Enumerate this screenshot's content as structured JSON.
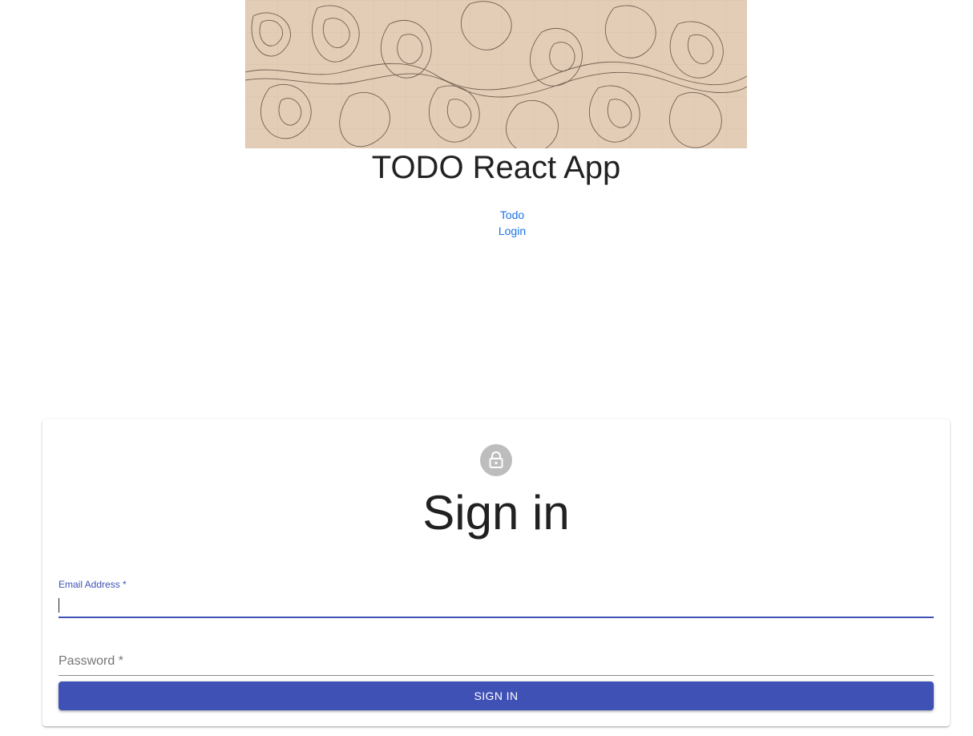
{
  "header": {
    "title": "TODO React App"
  },
  "nav": {
    "items": [
      {
        "label": "Todo"
      },
      {
        "label": "Login"
      }
    ]
  },
  "signin": {
    "title": "Sign in",
    "email_label": "Email Address *",
    "email_value": "",
    "password_label": "Password *",
    "password_value": "",
    "button_label": "SIGN IN",
    "avatar_icon": "lock-icon"
  },
  "colors": {
    "primary": "#3f51b5",
    "link": "#1a73e8",
    "avatar_bg": "#bdbdbd",
    "banner_bg": "#e3cdb6"
  }
}
